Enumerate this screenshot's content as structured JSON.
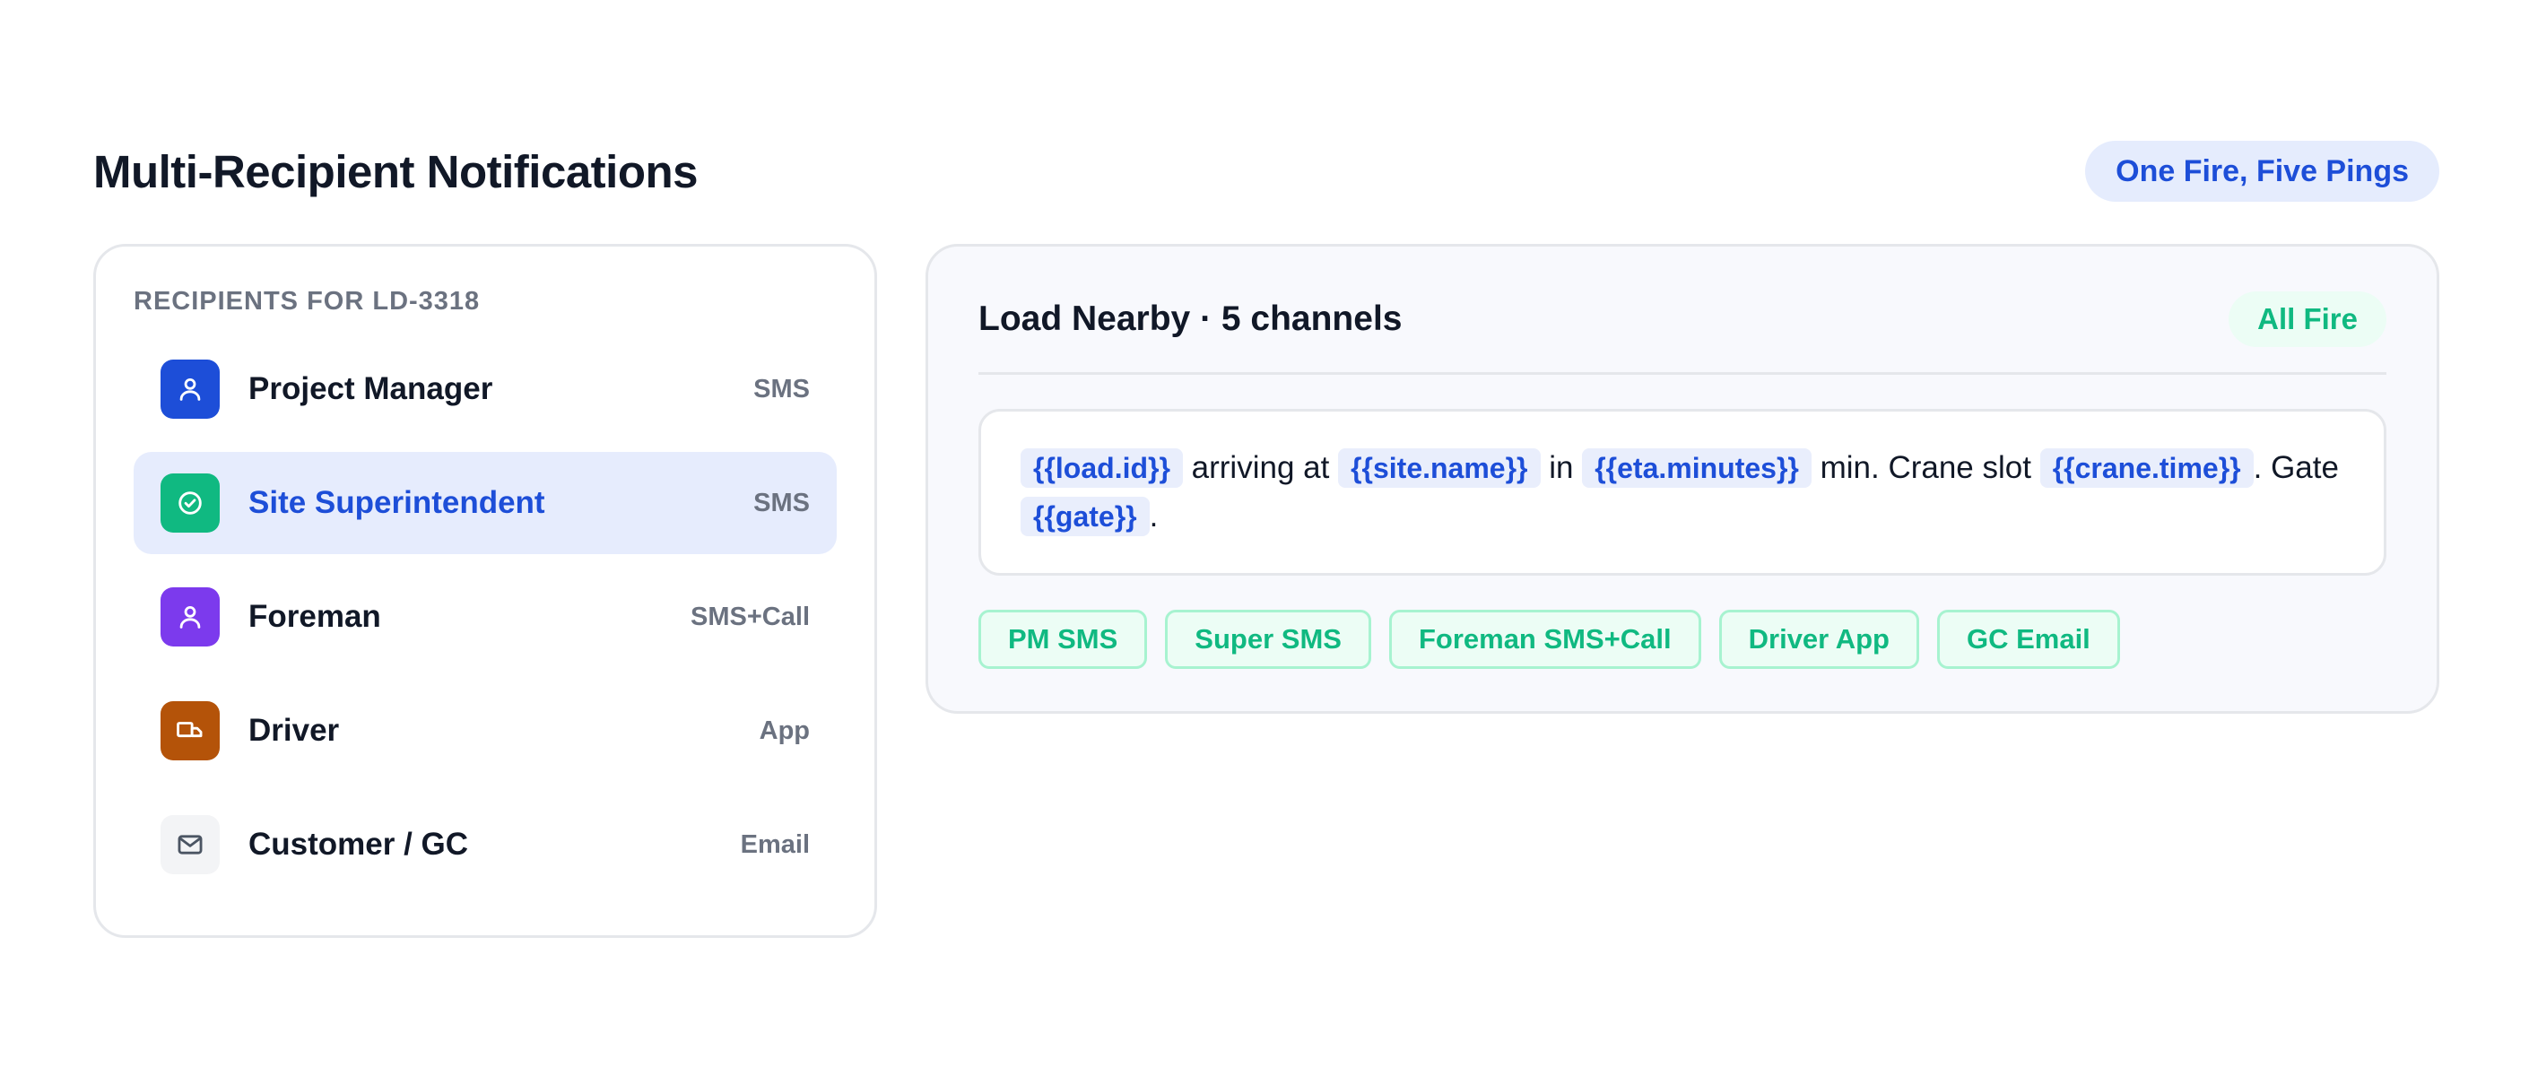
{
  "header": {
    "title": "Multi-Recipient Notifications",
    "pill": "One Fire, Five Pings"
  },
  "recipients": {
    "heading": "RECIPIENTS FOR LD-3318",
    "items": [
      {
        "name": "Project Manager",
        "channel": "SMS",
        "icon": "person-icon",
        "icon_bg": "#1d4ed8",
        "active": false
      },
      {
        "name": "Site Superintendent",
        "channel": "SMS",
        "icon": "check-circle-icon",
        "icon_bg": "#10b981",
        "active": true
      },
      {
        "name": "Foreman",
        "channel": "SMS+Call",
        "icon": "person-icon",
        "icon_bg": "#7c3aed",
        "active": false
      },
      {
        "name": "Driver",
        "channel": "App",
        "icon": "truck-icon",
        "icon_bg": "#b45309",
        "active": false
      },
      {
        "name": "Customer / GC",
        "channel": "Email",
        "icon": "mail-icon",
        "icon_bg": "#f3f4f6",
        "active": false
      }
    ]
  },
  "message": {
    "title": "Load Nearby · 5 channels",
    "status": "All Fire",
    "template": {
      "var_load": "{{load.id}}",
      "t1": "arriving at",
      "var_site": "{{site.name}}",
      "t2": "in",
      "var_eta": "{{eta.minutes}}",
      "t3": "min. Crane slot",
      "var_crane": "{{crane.time}}",
      "t4": ".",
      "t5": "Gate",
      "var_gate": "{{gate}}",
      "t6": "."
    },
    "channels": [
      "PM SMS",
      "Super SMS",
      "Foreman SMS+Call",
      "Driver App",
      "GC Email"
    ]
  },
  "colors": {
    "accent": "#1d4ed8",
    "success": "#10b981"
  }
}
